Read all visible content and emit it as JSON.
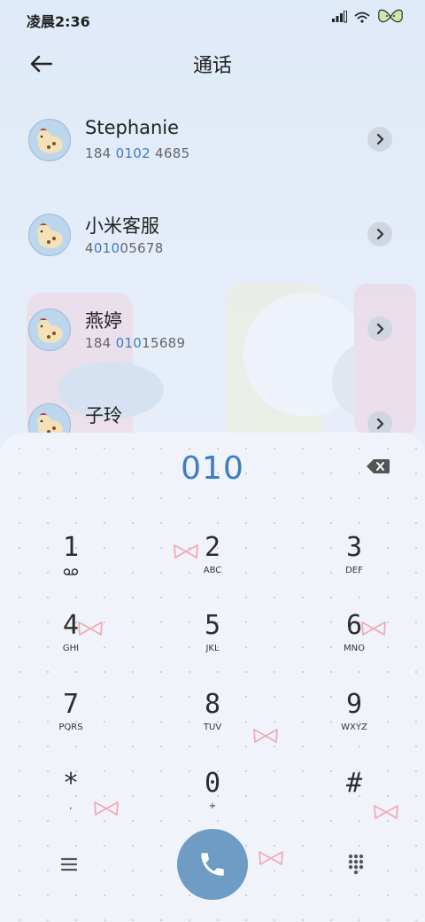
{
  "status_bar": {
    "time": "凌晨2:36"
  },
  "header": {
    "title": "通话"
  },
  "contacts": [
    {
      "name": "Stephanie",
      "num_pre": "184 ",
      "num_hl": "0102",
      "num_post": " 4685"
    },
    {
      "name": "小米客服",
      "num_pre": "4",
      "num_hl": "010",
      "num_post": "05678"
    },
    {
      "name": "燕婷",
      "num_pre": "184 ",
      "num_hl": "010",
      "num_post": "15689"
    },
    {
      "name": "子玲",
      "num_pre": "",
      "num_hl": "",
      "num_post": ""
    }
  ],
  "dialpad": {
    "input": "010",
    "keys": [
      {
        "digit": "1",
        "letters": ""
      },
      {
        "digit": "2",
        "letters": "ABC"
      },
      {
        "digit": "3",
        "letters": "DEF"
      },
      {
        "digit": "4",
        "letters": "GHI"
      },
      {
        "digit": "5",
        "letters": "JKL"
      },
      {
        "digit": "6",
        "letters": "MNO"
      },
      {
        "digit": "7",
        "letters": "PQRS"
      },
      {
        "digit": "8",
        "letters": "TUV"
      },
      {
        "digit": "9",
        "letters": "WXYZ"
      },
      {
        "digit": "*",
        "letters": ","
      },
      {
        "digit": "0",
        "letters": "+"
      },
      {
        "digit": "#",
        "letters": ""
      }
    ]
  },
  "icons": {
    "back": "back-arrow-icon",
    "contact_arrow": "chevron-right-icon",
    "backspace": "backspace-icon",
    "voicemail": "voicemail-icon",
    "menu": "menu-icon",
    "call": "phone-icon",
    "dialpad_toggle": "dialpad-icon"
  },
  "colors": {
    "accent": "#3f7dbf",
    "call_button": "#6f9cc4",
    "bow": "#f2a9b8"
  }
}
